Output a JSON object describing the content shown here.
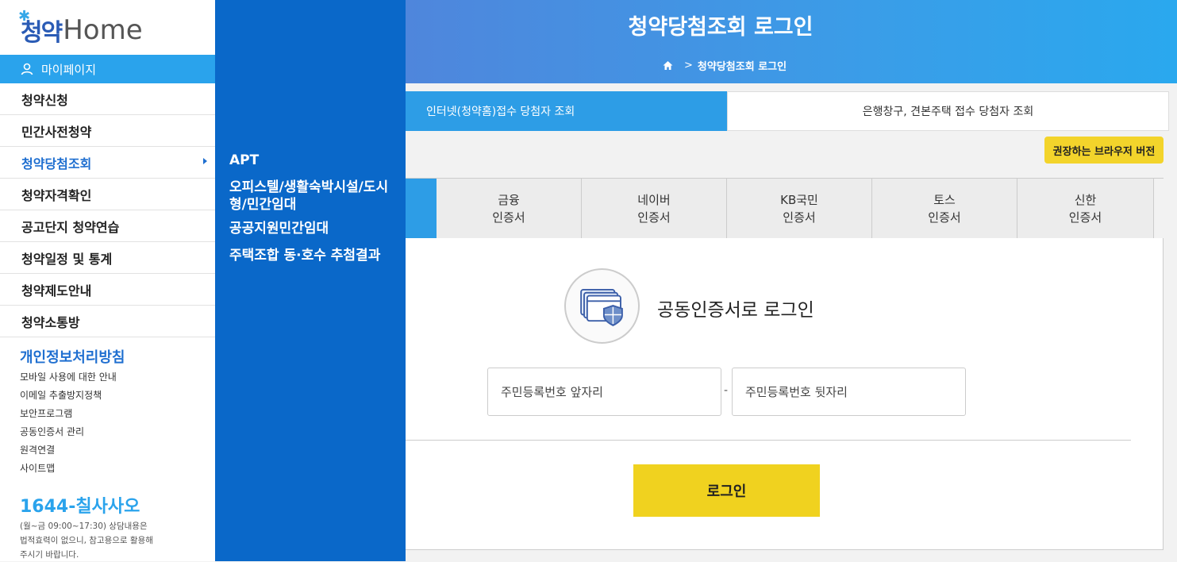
{
  "logo": {
    "kor": "청약",
    "eng": "Home"
  },
  "sidebar": {
    "mypage": "마이페이지",
    "items": [
      {
        "label": "청약신청"
      },
      {
        "label": "민간사전청약"
      },
      {
        "label": "청약당첨조회"
      },
      {
        "label": "청약자격확인"
      },
      {
        "label": "공고단지 청약연습"
      },
      {
        "label": "청약일정 및 통계"
      },
      {
        "label": "청약제도안내"
      },
      {
        "label": "청약소통방"
      }
    ],
    "privacy": "개인정보처리방침",
    "links": [
      "모바일 사용에 대한 안내",
      "이메일 추출방지정책",
      "보안프로그램",
      "공동인증서 관리",
      "원격연결",
      "사이트맵"
    ],
    "phone": "1644-칠사사오",
    "hours": "(월~금 09:00~17:30) 상담내용은\n법적효력이 없으니, 참고용으로 활용해\n주시기 바랍니다."
  },
  "submenu": {
    "items": [
      "APT",
      "오피스텔/생활숙박시설/도시형/민간임대",
      "공공지원민간임대",
      "주택조합 동·호수 추첨결과"
    ]
  },
  "header": {
    "title": "청약당첨조회 로그인",
    "breadcrumb": "청약당첨조회 로그인"
  },
  "tabs": {
    "active": "인터넷(청약홈)접수 당첨자 조회",
    "inactive": "은행창구, 견본주택 접수 당첨자 조회"
  },
  "browser_button": "권장하는 브라우저 버전",
  "cert_tabs": [
    {
      "line1": "금융",
      "line2": "인증서"
    },
    {
      "line1": "네이버",
      "line2": "인증서"
    },
    {
      "line1": "KB국민",
      "line2": "인증서"
    },
    {
      "line1": "토스",
      "line2": "인증서"
    },
    {
      "line1": "신한",
      "line2": "인증서"
    }
  ],
  "login": {
    "cert_label": "공동인증서로 로그인",
    "ssn_front_placeholder": "주민등록번호 앞자리",
    "ssn_separator": "-",
    "ssn_back_placeholder": "주민등록번호 뒷자리",
    "button": "로그인"
  },
  "colors": {
    "accent": "#2d9de6",
    "submenu_bg": "#0a68c9",
    "button_yellow": "#f0d21f"
  }
}
